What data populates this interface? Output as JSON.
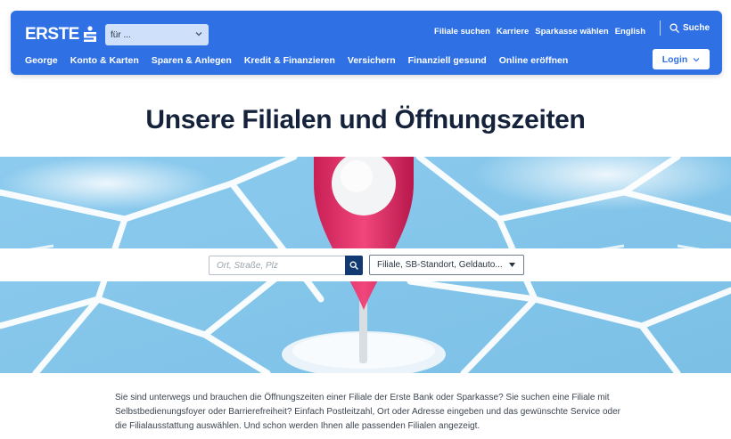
{
  "header": {
    "logo": {
      "text": "ERSTE",
      "mark_icon": "sparkasse-s-icon"
    },
    "for_select": {
      "value": "für ..."
    },
    "top_links": [
      "Filiale suchen",
      "Karriere",
      "Sparkasse wählen",
      "English"
    ],
    "search_label": "Suche",
    "nav": [
      "George",
      "Konto & Karten",
      "Sparen & Anlegen",
      "Kredit & Finanzieren",
      "Versichern",
      "Finanziell gesund",
      "Online eröffnen"
    ],
    "login_label": "Login",
    "colors": {
      "brand": "#2f70e4",
      "white": "#ffffff"
    }
  },
  "page_title": "Unsere Filialen und Öffnungszeiten",
  "search": {
    "placeholder": "Ort, Straße, Plz",
    "value": "",
    "button_icon": "search-icon",
    "type_select_value": "Filiale, SB-Standort, Geldauto..."
  },
  "hero": {
    "image": "map-pin-on-map-illustration",
    "colors": {
      "map": "#8fcbea",
      "pin": "#e0306a",
      "roads": "#ffffff"
    }
  },
  "intro": "Sie sind unterwegs und brauchen die Öffnungszeiten einer Filiale der Erste Bank oder Sparkasse? Sie suchen eine Filiale mit Selbstbedienungsfoyer oder Barrierefreiheit? Einfach Postleitzahl, Ort oder Adresse eingeben und das gewünschte Service oder die Filialausstattung auswählen. Und schon werden Ihnen alle passenden Filialen angezeigt."
}
